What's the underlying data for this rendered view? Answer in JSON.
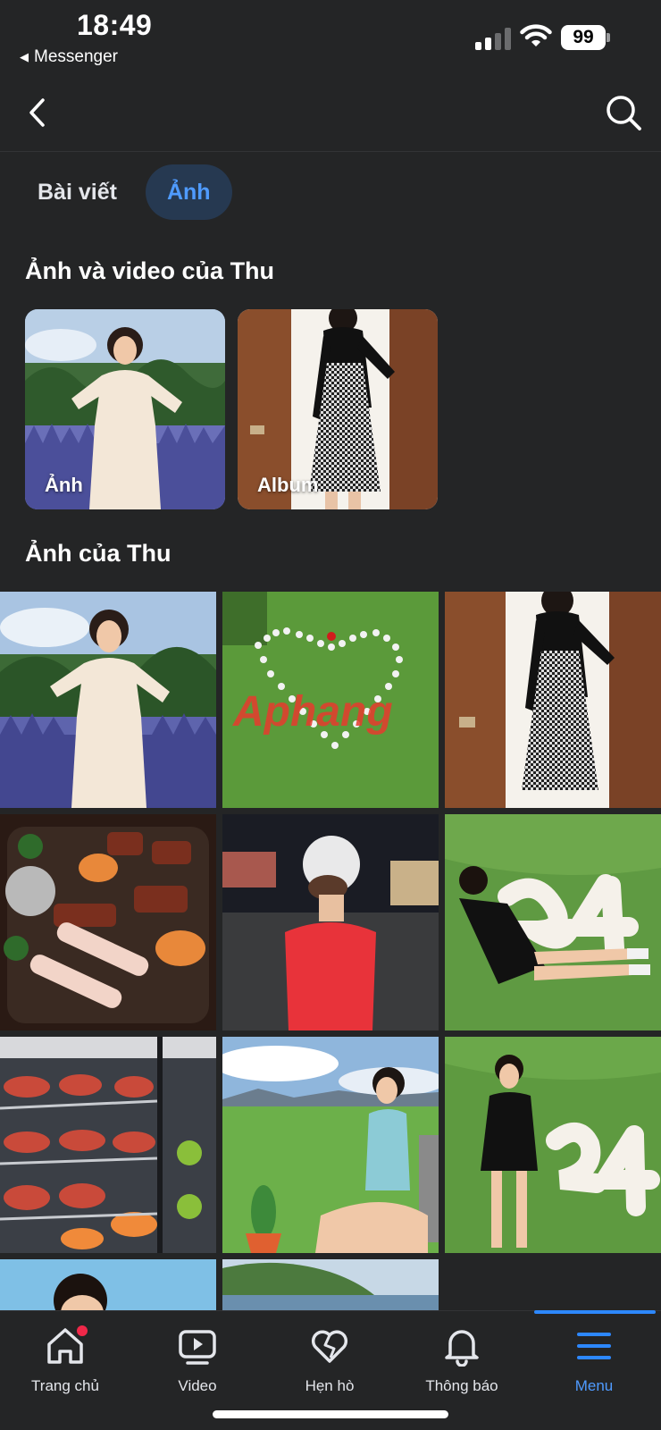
{
  "status_bar": {
    "time": "18:49",
    "back_app": "Messenger",
    "battery": "99"
  },
  "header": {
    "back_icon": "chevron-left-icon",
    "search_icon": "search-icon"
  },
  "tabs": [
    {
      "label": "Bài viết",
      "active": false
    },
    {
      "label": "Ảnh",
      "active": true
    }
  ],
  "albums_section": {
    "title": "Ảnh và video của Thu",
    "cards": [
      {
        "label": "Ảnh"
      },
      {
        "label": "Album"
      }
    ]
  },
  "photos_section": {
    "title": "Ảnh của Thu",
    "watermark": "Aphang"
  },
  "bottom_nav": [
    {
      "label": "Trang chủ",
      "icon": "home-icon",
      "badge": true,
      "active": false
    },
    {
      "label": "Video",
      "icon": "video-icon",
      "badge": false,
      "active": false
    },
    {
      "label": "Hẹn hò",
      "icon": "heart-icon",
      "badge": false,
      "active": false
    },
    {
      "label": "Thông báo",
      "icon": "bell-icon",
      "badge": false,
      "active": false
    },
    {
      "label": "Menu",
      "icon": "menu-icon",
      "badge": false,
      "active": true
    }
  ],
  "colors": {
    "background": "#242526",
    "accent": "#4f9bff",
    "active_tab_bg": "#263951",
    "badge": "#f02849"
  }
}
